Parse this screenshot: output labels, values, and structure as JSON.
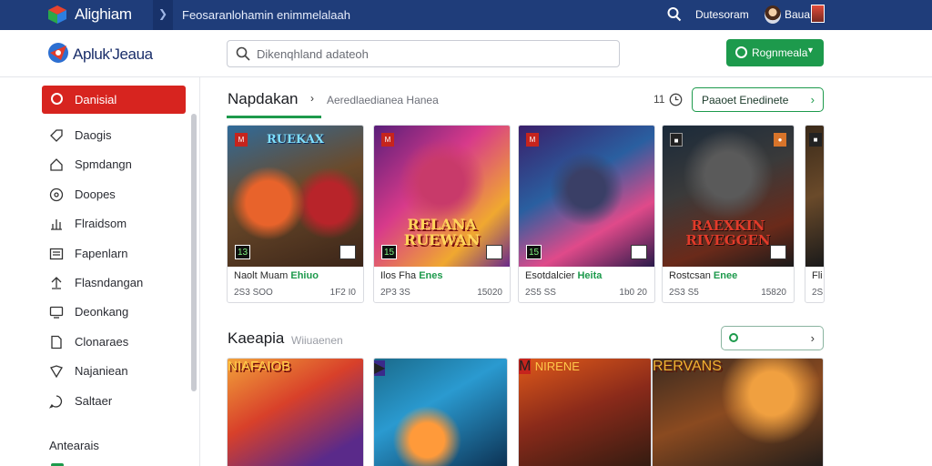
{
  "topbar": {
    "app_title": "Alighiam",
    "breadcrumb": "Feosaranlohamin enimmelalaah",
    "link": "Dutesoram",
    "user": "Baua",
    "colors": {
      "bar": "#1f3d7a"
    }
  },
  "header": {
    "brand": "Apluk'Jeaua",
    "search_placeholder": "Dikenqhland adateoh",
    "action_button": "Rognmeala"
  },
  "sidebar": {
    "active_label": "Danisial",
    "items": [
      {
        "label": "Daogis",
        "icon": "tag-icon"
      },
      {
        "label": "Spmdangn",
        "icon": "home-icon"
      },
      {
        "label": "Doopes",
        "icon": "disc-icon"
      },
      {
        "label": "Flraidsom",
        "icon": "chart-icon"
      },
      {
        "label": "Fapenlarn",
        "icon": "list-icon"
      },
      {
        "label": "Flasndangan",
        "icon": "upload-icon"
      },
      {
        "label": "Deonkang",
        "icon": "screen-icon"
      },
      {
        "label": "Clonaraes",
        "icon": "file-icon"
      },
      {
        "label": "Najaniean",
        "icon": "shield-icon"
      },
      {
        "label": "Saltaer",
        "icon": "chat-icon"
      }
    ],
    "section_heading": "Antearais",
    "colors": {
      "active": "#d7241f"
    }
  },
  "section1": {
    "title": "Napdakan",
    "subtitle": "Aeredlaedianea  Hanea",
    "count": "11",
    "filter_label": "Paaoet Enedinete",
    "cards": [
      {
        "title_prefix": "Naolt Muam",
        "title_accent": "Ehiuo",
        "left": "2S3 SOO",
        "right": "1F2 I0",
        "rating": "13",
        "logo_text": "RUEKAX"
      },
      {
        "title_prefix": "Ilos Fha",
        "title_accent": "Enes",
        "left": "2P3 3S",
        "right": "15020",
        "rating": "15",
        "logo_text": "RELANA RUEWAN"
      },
      {
        "title_prefix": "Esotdalcier",
        "title_accent": "Heita",
        "left": "2S5 SS",
        "right": "1b0 20",
        "rating": "15",
        "logo_text": ""
      },
      {
        "title_prefix": "Rostcsan",
        "title_accent": "Enee",
        "left": "2S3 S5",
        "right": "15820",
        "rating": "",
        "logo_text": "RAEXKIN RIVEGGEN"
      },
      {
        "title_prefix": "Fli",
        "title_accent": "",
        "left": "2S",
        "right": "",
        "rating": "",
        "logo_text": ""
      }
    ]
  },
  "section2": {
    "title": "Kaeapia",
    "subtitle": "Wiiuaenen",
    "filter_label": "O",
    "cards": [
      {
        "logo_text": "NIAFAIOB"
      },
      {
        "logo_text": ""
      },
      {
        "logo_text": "NIRENE"
      },
      {
        "logo_text": "RERVANS"
      }
    ]
  },
  "colors": {
    "accent": "#1d9a4c",
    "danger": "#d7241f"
  }
}
